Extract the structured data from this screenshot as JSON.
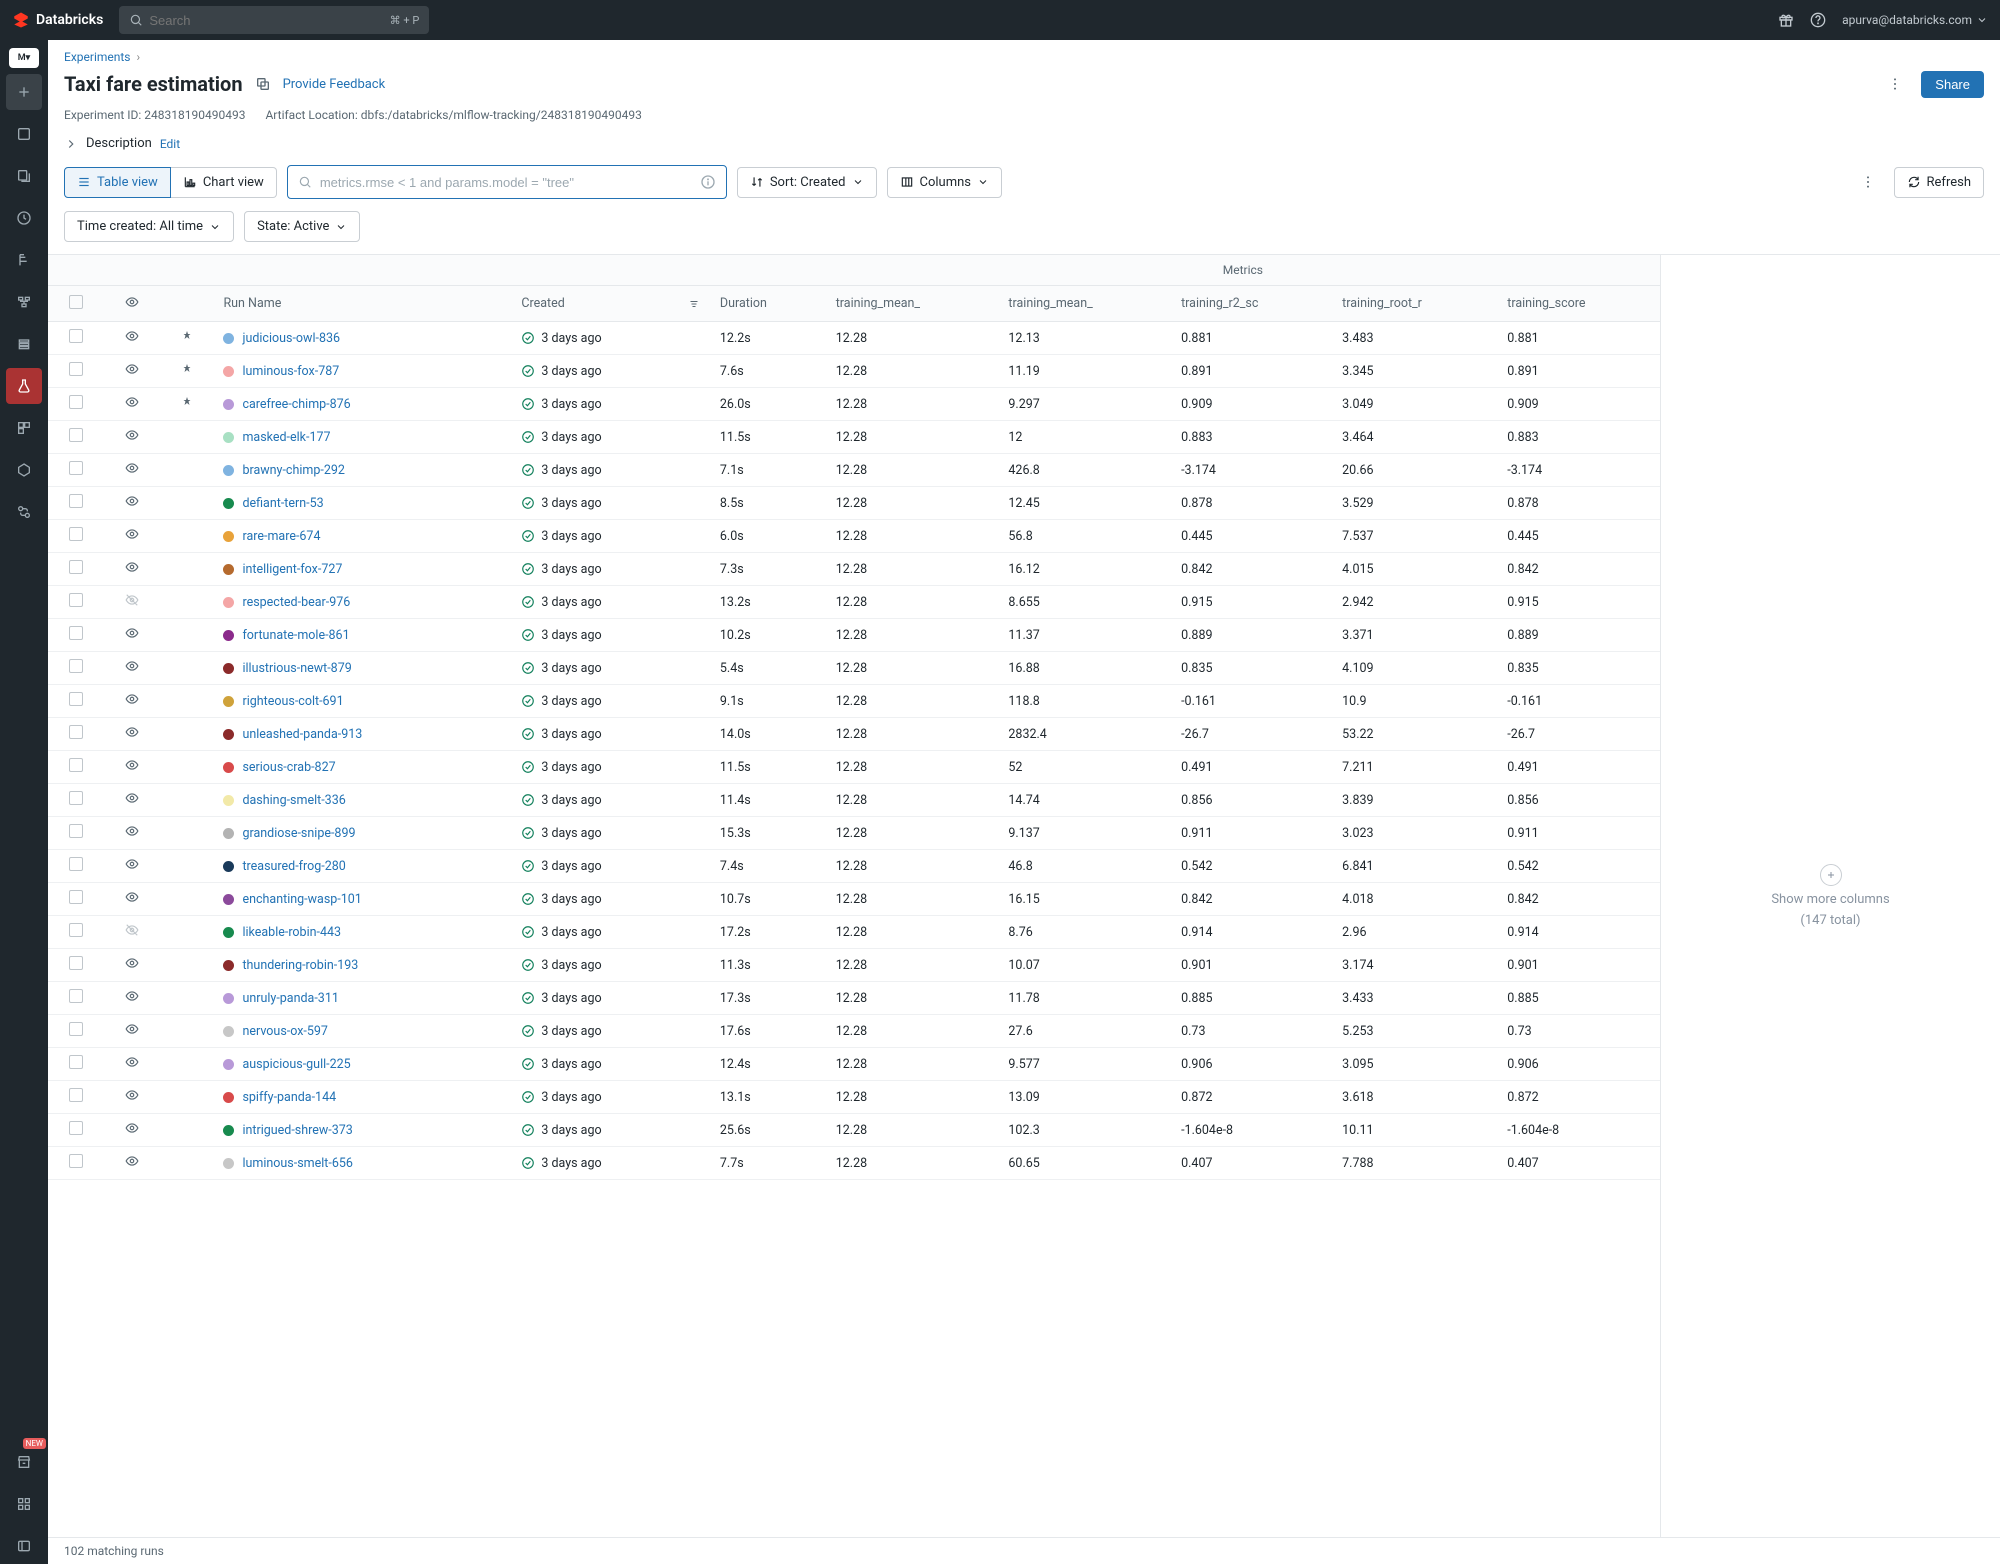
{
  "topbar": {
    "brand": "Databricks",
    "search_placeholder": "Search",
    "shortcut": "⌘ + P",
    "user_email": "apurva@databricks.com"
  },
  "breadcrumbs": {
    "root": "Experiments"
  },
  "page": {
    "title": "Taxi fare estimation",
    "feedback_label": "Provide Feedback",
    "experiment_id_label": "Experiment ID: 248318190490493",
    "artifact_label": "Artifact Location: dbfs:/databricks/mlflow-tracking/248318190490493",
    "description_label": "Description",
    "edit_label": "Edit",
    "share_label": "Share"
  },
  "toolbar": {
    "table_view": "Table view",
    "chart_view": "Chart view",
    "search_placeholder": "metrics.rmse < 1 and params.model = \"tree\"",
    "sort_label": "Sort: Created",
    "columns_label": "Columns",
    "refresh_label": "Refresh",
    "time_filter_label": "Time created: All time",
    "state_filter_label": "State: Active"
  },
  "table": {
    "group_metrics": "Metrics",
    "columns": {
      "run_name": "Run Name",
      "created": "Created",
      "duration": "Duration",
      "m0": "training_mean_",
      "m1": "training_mean_",
      "m2": "training_r2_sc",
      "m3": "training_root_r",
      "m4": "training_score"
    }
  },
  "more_cols": {
    "line1": "Show more columns",
    "line2": "(147 total)"
  },
  "footer": {
    "text": "102 matching runs"
  },
  "runs": [
    {
      "name": "judicious-owl-836",
      "color": "#7fb3e0",
      "pinned": true,
      "visible": true,
      "created": "3 days ago",
      "duration": "12.2s",
      "m0": "12.28",
      "m1": "12.13",
      "m2": "0.881",
      "m3": "3.483",
      "m4": "0.881"
    },
    {
      "name": "luminous-fox-787",
      "color": "#f4a6a6",
      "pinned": true,
      "visible": true,
      "created": "3 days ago",
      "duration": "7.6s",
      "m0": "12.28",
      "m1": "11.19",
      "m2": "0.891",
      "m3": "3.345",
      "m4": "0.891"
    },
    {
      "name": "carefree-chimp-876",
      "color": "#b899d8",
      "pinned": true,
      "visible": true,
      "created": "3 days ago",
      "duration": "26.0s",
      "m0": "12.28",
      "m1": "9.297",
      "m2": "0.909",
      "m3": "3.049",
      "m4": "0.909"
    },
    {
      "name": "masked-elk-177",
      "color": "#a8e0c3",
      "pinned": false,
      "visible": true,
      "created": "3 days ago",
      "duration": "11.5s",
      "m0": "12.28",
      "m1": "12",
      "m2": "0.883",
      "m3": "3.464",
      "m4": "0.883"
    },
    {
      "name": "brawny-chimp-292",
      "color": "#7fb3e0",
      "pinned": false,
      "visible": true,
      "created": "3 days ago",
      "duration": "7.1s",
      "m0": "12.28",
      "m1": "426.8",
      "m2": "-3.174",
      "m3": "20.66",
      "m4": "-3.174"
    },
    {
      "name": "defiant-tern-53",
      "color": "#178a4e",
      "pinned": false,
      "visible": true,
      "created": "3 days ago",
      "duration": "8.5s",
      "m0": "12.28",
      "m1": "12.45",
      "m2": "0.878",
      "m3": "3.529",
      "m4": "0.878"
    },
    {
      "name": "rare-mare-674",
      "color": "#e8a23a",
      "pinned": false,
      "visible": true,
      "created": "3 days ago",
      "duration": "6.0s",
      "m0": "12.28",
      "m1": "56.8",
      "m2": "0.445",
      "m3": "7.537",
      "m4": "0.445"
    },
    {
      "name": "intelligent-fox-727",
      "color": "#b56a2e",
      "pinned": false,
      "visible": true,
      "created": "3 days ago",
      "duration": "7.3s",
      "m0": "12.28",
      "m1": "16.12",
      "m2": "0.842",
      "m3": "4.015",
      "m4": "0.842"
    },
    {
      "name": "respected-bear-976",
      "color": "#f4a6a6",
      "pinned": false,
      "visible": false,
      "created": "3 days ago",
      "duration": "13.2s",
      "m0": "12.28",
      "m1": "8.655",
      "m2": "0.915",
      "m3": "2.942",
      "m4": "0.915"
    },
    {
      "name": "fortunate-mole-861",
      "color": "#8b2a8b",
      "pinned": false,
      "visible": true,
      "created": "3 days ago",
      "duration": "10.2s",
      "m0": "12.28",
      "m1": "11.37",
      "m2": "0.889",
      "m3": "3.371",
      "m4": "0.889"
    },
    {
      "name": "illustrious-newt-879",
      "color": "#8b2a2a",
      "pinned": false,
      "visible": true,
      "created": "3 days ago",
      "duration": "5.4s",
      "m0": "12.28",
      "m1": "16.88",
      "m2": "0.835",
      "m3": "4.109",
      "m4": "0.835"
    },
    {
      "name": "righteous-colt-691",
      "color": "#cfa23a",
      "pinned": false,
      "visible": true,
      "created": "3 days ago",
      "duration": "9.1s",
      "m0": "12.28",
      "m1": "118.8",
      "m2": "-0.161",
      "m3": "10.9",
      "m4": "-0.161"
    },
    {
      "name": "unleashed-panda-913",
      "color": "#8b2a2a",
      "pinned": false,
      "visible": true,
      "created": "3 days ago",
      "duration": "14.0s",
      "m0": "12.28",
      "m1": "2832.4",
      "m2": "-26.7",
      "m3": "53.22",
      "m4": "-26.7"
    },
    {
      "name": "serious-crab-827",
      "color": "#d84a4a",
      "pinned": false,
      "visible": true,
      "created": "3 days ago",
      "duration": "11.5s",
      "m0": "12.28",
      "m1": "52",
      "m2": "0.491",
      "m3": "7.211",
      "m4": "0.491"
    },
    {
      "name": "dashing-smelt-336",
      "color": "#f2e9a8",
      "pinned": false,
      "visible": true,
      "created": "3 days ago",
      "duration": "11.4s",
      "m0": "12.28",
      "m1": "14.74",
      "m2": "0.856",
      "m3": "3.839",
      "m4": "0.856"
    },
    {
      "name": "grandiose-snipe-899",
      "color": "#b3b3b3",
      "pinned": false,
      "visible": true,
      "created": "3 days ago",
      "duration": "15.3s",
      "m0": "12.28",
      "m1": "9.137",
      "m2": "0.911",
      "m3": "3.023",
      "m4": "0.911"
    },
    {
      "name": "treasured-frog-280",
      "color": "#1a3a5a",
      "pinned": false,
      "visible": true,
      "created": "3 days ago",
      "duration": "7.4s",
      "m0": "12.28",
      "m1": "46.8",
      "m2": "0.542",
      "m3": "6.841",
      "m4": "0.542"
    },
    {
      "name": "enchanting-wasp-101",
      "color": "#8b4a9b",
      "pinned": false,
      "visible": true,
      "created": "3 days ago",
      "duration": "10.7s",
      "m0": "12.28",
      "m1": "16.15",
      "m2": "0.842",
      "m3": "4.018",
      "m4": "0.842"
    },
    {
      "name": "likeable-robin-443",
      "color": "#178a4e",
      "pinned": false,
      "visible": false,
      "created": "3 days ago",
      "duration": "17.2s",
      "m0": "12.28",
      "m1": "8.76",
      "m2": "0.914",
      "m3": "2.96",
      "m4": "0.914"
    },
    {
      "name": "thundering-robin-193",
      "color": "#8b2a2a",
      "pinned": false,
      "visible": true,
      "created": "3 days ago",
      "duration": "11.3s",
      "m0": "12.28",
      "m1": "10.07",
      "m2": "0.901",
      "m3": "3.174",
      "m4": "0.901"
    },
    {
      "name": "unruly-panda-311",
      "color": "#b899d8",
      "pinned": false,
      "visible": true,
      "created": "3 days ago",
      "duration": "17.3s",
      "m0": "12.28",
      "m1": "11.78",
      "m2": "0.885",
      "m3": "3.433",
      "m4": "0.885"
    },
    {
      "name": "nervous-ox-597",
      "color": "#c7c7c7",
      "pinned": false,
      "visible": true,
      "created": "3 days ago",
      "duration": "17.6s",
      "m0": "12.28",
      "m1": "27.6",
      "m2": "0.73",
      "m3": "5.253",
      "m4": "0.73"
    },
    {
      "name": "auspicious-gull-225",
      "color": "#b899d8",
      "pinned": false,
      "visible": true,
      "created": "3 days ago",
      "duration": "12.4s",
      "m0": "12.28",
      "m1": "9.577",
      "m2": "0.906",
      "m3": "3.095",
      "m4": "0.906"
    },
    {
      "name": "spiffy-panda-144",
      "color": "#d84a4a",
      "pinned": false,
      "visible": true,
      "created": "3 days ago",
      "duration": "13.1s",
      "m0": "12.28",
      "m1": "13.09",
      "m2": "0.872",
      "m3": "3.618",
      "m4": "0.872"
    },
    {
      "name": "intrigued-shrew-373",
      "color": "#178a4e",
      "pinned": false,
      "visible": true,
      "created": "3 days ago",
      "duration": "25.6s",
      "m0": "12.28",
      "m1": "102.3",
      "m2": "-1.604e-8",
      "m3": "10.11",
      "m4": "-1.604e-8"
    },
    {
      "name": "luminous-smelt-656",
      "color": "#c7c7c7",
      "pinned": false,
      "visible": true,
      "created": "3 days ago",
      "duration": "7.7s",
      "m0": "12.28",
      "m1": "60.65",
      "m2": "0.407",
      "m3": "7.788",
      "m4": "0.407"
    }
  ]
}
